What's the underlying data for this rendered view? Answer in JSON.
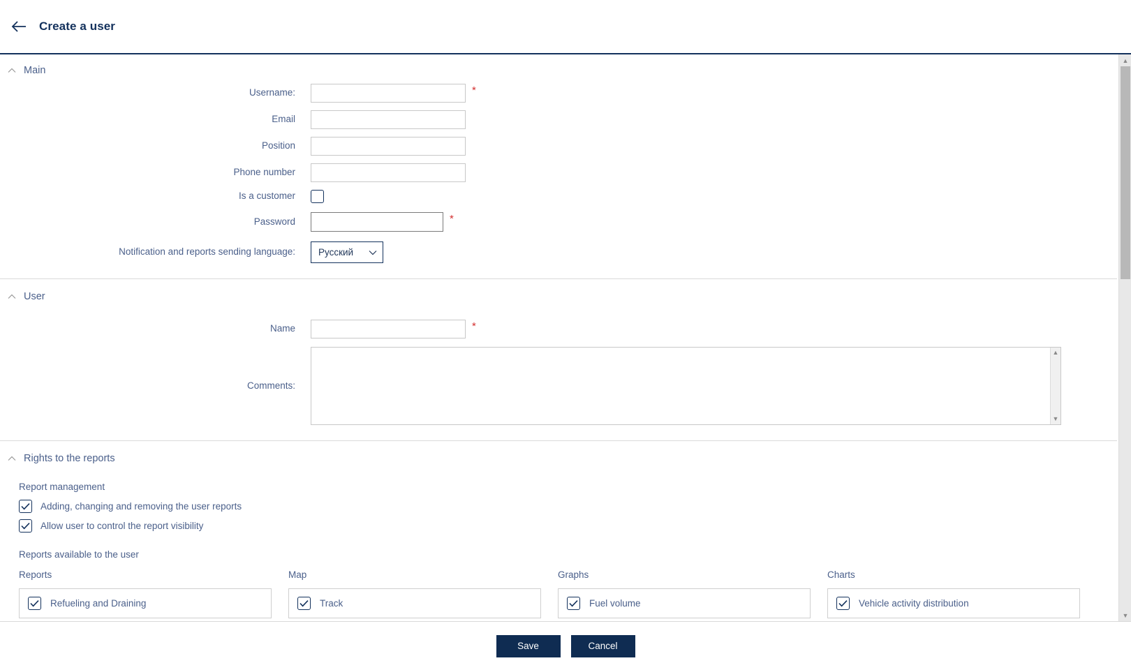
{
  "header": {
    "title": "Create a user",
    "back_icon": "arrow-left-icon"
  },
  "sections": {
    "main": {
      "title": "Main",
      "collapse_icon": "chevron-up-icon",
      "fields": {
        "username": {
          "label": "Username:",
          "value": "",
          "placeholder": "",
          "required": true
        },
        "email": {
          "label": "Email",
          "value": "",
          "placeholder": "",
          "required": false
        },
        "position": {
          "label": "Position",
          "value": "",
          "placeholder": "",
          "required": false
        },
        "phone": {
          "label": "Phone number",
          "value": "",
          "placeholder": "",
          "required": false
        },
        "is_customer": {
          "label": "Is a customer",
          "checked": false
        },
        "password": {
          "label": "Password",
          "value": "",
          "placeholder": "",
          "required": true
        },
        "language": {
          "label": "Notification and reports sending language:",
          "value": "Русский",
          "chevron_icon": "chevron-down-icon"
        }
      },
      "required_marker": "*"
    },
    "user": {
      "title": "User",
      "collapse_icon": "chevron-up-icon",
      "fields": {
        "name": {
          "label": "Name",
          "value": "",
          "placeholder": "",
          "required": true
        },
        "comments": {
          "label": "Comments:",
          "value": "",
          "placeholder": ""
        }
      },
      "required_marker": "*"
    },
    "rights": {
      "title": "Rights to the reports",
      "collapse_icon": "chevron-up-icon",
      "report_management_title": "Report management",
      "permissions": [
        {
          "label": "Adding, changing and removing the user reports",
          "checked": true
        },
        {
          "label": "Allow user to control the report visibility",
          "checked": true
        }
      ],
      "available_title": "Reports available to the user",
      "columns": [
        {
          "title": "Reports",
          "items": [
            {
              "label": "Refueling and Draining",
              "checked": true
            }
          ]
        },
        {
          "title": "Map",
          "items": [
            {
              "label": "Track",
              "checked": true
            }
          ]
        },
        {
          "title": "Graphs",
          "items": [
            {
              "label": "Fuel volume",
              "checked": true
            }
          ]
        },
        {
          "title": "Charts",
          "items": [
            {
              "label": "Vehicle activity distribution",
              "checked": true
            }
          ]
        }
      ]
    }
  },
  "footer": {
    "save_label": "Save",
    "cancel_label": "Cancel"
  },
  "scrollbar": {
    "up_arrow": "▲",
    "down_arrow": "▼"
  },
  "colors": {
    "accent_navy": "#13315c",
    "button_navy": "#0f2c52",
    "label_blue": "#4a5f8a",
    "required_red": "#d32f2f"
  }
}
